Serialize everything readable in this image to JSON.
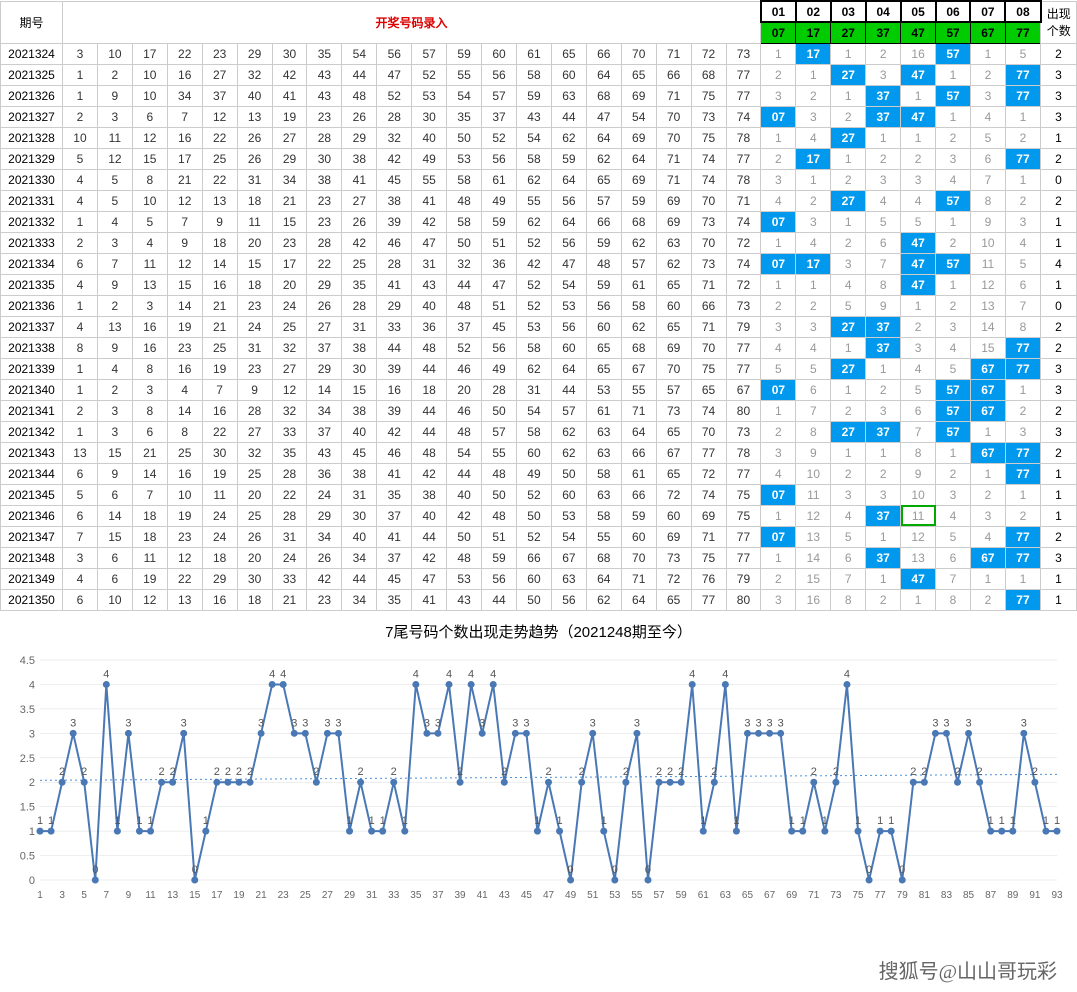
{
  "headers": {
    "period": "期号",
    "draw": "开奖号码录入",
    "count": "出现\n个数",
    "cols": [
      "01",
      "02",
      "03",
      "04",
      "05",
      "06",
      "07",
      "08"
    ],
    "row2": [
      "07",
      "17",
      "27",
      "37",
      "47",
      "57",
      "67",
      "77"
    ]
  },
  "rows": [
    {
      "p": "2021324",
      "d": [
        3,
        10,
        17,
        22,
        23,
        29,
        30,
        35,
        54,
        56,
        57,
        59,
        60,
        61,
        65,
        66,
        70,
        71,
        72,
        73
      ],
      "t": [
        1,
        17,
        1,
        2,
        16,
        57,
        1,
        5
      ],
      "h": [
        0,
        1,
        0,
        0,
        0,
        1,
        0,
        0
      ],
      "c": 2
    },
    {
      "p": "2021325",
      "d": [
        1,
        2,
        10,
        16,
        27,
        32,
        42,
        43,
        44,
        47,
        52,
        55,
        56,
        58,
        60,
        64,
        65,
        66,
        68,
        77
      ],
      "t": [
        2,
        1,
        27,
        3,
        47,
        1,
        2,
        77
      ],
      "h": [
        0,
        0,
        1,
        0,
        1,
        0,
        0,
        1
      ],
      "c": 3
    },
    {
      "p": "2021326",
      "d": [
        1,
        9,
        10,
        34,
        37,
        40,
        41,
        43,
        48,
        52,
        53,
        54,
        57,
        59,
        63,
        68,
        69,
        71,
        75,
        77
      ],
      "t": [
        3,
        2,
        1,
        37,
        1,
        57,
        3,
        77
      ],
      "h": [
        0,
        0,
        0,
        1,
        0,
        1,
        0,
        1
      ],
      "c": 3
    },
    {
      "p": "2021327",
      "d": [
        2,
        3,
        6,
        7,
        12,
        13,
        19,
        23,
        26,
        28,
        30,
        35,
        37,
        43,
        44,
        47,
        54,
        70,
        73,
        74
      ],
      "t": [
        7,
        3,
        2,
        37,
        47,
        1,
        4,
        1
      ],
      "h": [
        1,
        0,
        0,
        1,
        1,
        0,
        0,
        0
      ],
      "c": 3,
      "tval": [
        "07",
        3,
        2,
        37,
        47,
        1,
        4,
        1
      ]
    },
    {
      "p": "2021328",
      "d": [
        10,
        11,
        12,
        16,
        22,
        26,
        27,
        28,
        29,
        32,
        40,
        50,
        52,
        54,
        62,
        64,
        69,
        70,
        75,
        78
      ],
      "t": [
        1,
        4,
        27,
        1,
        1,
        2,
        5,
        2
      ],
      "h": [
        0,
        0,
        1,
        0,
        0,
        0,
        0,
        0
      ],
      "c": 1
    },
    {
      "p": "2021329",
      "d": [
        5,
        12,
        15,
        17,
        25,
        26,
        29,
        30,
        38,
        42,
        49,
        53,
        56,
        58,
        59,
        62,
        64,
        71,
        74,
        77
      ],
      "t": [
        2,
        17,
        1,
        2,
        2,
        3,
        6,
        77
      ],
      "h": [
        0,
        1,
        0,
        0,
        0,
        0,
        0,
        1
      ],
      "c": 2
    },
    {
      "p": "2021330",
      "d": [
        4,
        5,
        8,
        21,
        22,
        31,
        34,
        38,
        41,
        45,
        55,
        58,
        61,
        62,
        64,
        65,
        69,
        71,
        74,
        78
      ],
      "t": [
        3,
        1,
        2,
        3,
        3,
        4,
        7,
        1
      ],
      "h": [
        0,
        0,
        0,
        0,
        0,
        0,
        0,
        0
      ],
      "c": 0
    },
    {
      "p": "2021331",
      "d": [
        4,
        5,
        10,
        12,
        13,
        18,
        21,
        23,
        27,
        38,
        41,
        48,
        49,
        55,
        56,
        57,
        59,
        69,
        70,
        71
      ],
      "t": [
        4,
        2,
        27,
        4,
        4,
        57,
        8,
        2
      ],
      "h": [
        0,
        0,
        1,
        0,
        0,
        1,
        0,
        0
      ],
      "c": 2
    },
    {
      "p": "2021332",
      "d": [
        1,
        4,
        5,
        7,
        9,
        11,
        15,
        23,
        26,
        39,
        42,
        58,
        59,
        62,
        64,
        66,
        68,
        69,
        73,
        74
      ],
      "t": [
        7,
        3,
        1,
        5,
        5,
        1,
        9,
        3
      ],
      "h": [
        1,
        0,
        0,
        0,
        0,
        0,
        0,
        0
      ],
      "c": 1,
      "tval": [
        "07",
        3,
        1,
        5,
        5,
        1,
        9,
        3
      ]
    },
    {
      "p": "2021333",
      "d": [
        2,
        3,
        4,
        9,
        18,
        20,
        23,
        28,
        42,
        46,
        47,
        50,
        51,
        52,
        56,
        59,
        62,
        63,
        70,
        72
      ],
      "t": [
        1,
        4,
        2,
        6,
        47,
        2,
        10,
        4
      ],
      "h": [
        0,
        0,
        0,
        0,
        1,
        0,
        0,
        0
      ],
      "c": 1
    },
    {
      "p": "2021334",
      "d": [
        6,
        7,
        11,
        12,
        14,
        15,
        17,
        22,
        25,
        28,
        31,
        32,
        36,
        42,
        47,
        48,
        57,
        62,
        73,
        74
      ],
      "t": [
        7,
        17,
        3,
        7,
        47,
        57,
        11,
        5
      ],
      "h": [
        1,
        1,
        0,
        0,
        1,
        1,
        0,
        0
      ],
      "c": 4,
      "tval": [
        "07",
        17,
        3,
        7,
        47,
        57,
        11,
        5
      ]
    },
    {
      "p": "2021335",
      "d": [
        4,
        9,
        13,
        15,
        16,
        18,
        20,
        29,
        35,
        41,
        43,
        44,
        47,
        52,
        54,
        59,
        61,
        65,
        71,
        72
      ],
      "t": [
        1,
        1,
        4,
        8,
        47,
        1,
        12,
        6
      ],
      "h": [
        0,
        0,
        0,
        0,
        1,
        0,
        0,
        0
      ],
      "c": 1
    },
    {
      "p": "2021336",
      "d": [
        1,
        2,
        3,
        14,
        21,
        23,
        24,
        26,
        28,
        29,
        40,
        48,
        51,
        52,
        53,
        56,
        58,
        60,
        66,
        73
      ],
      "t": [
        2,
        2,
        5,
        9,
        1,
        2,
        13,
        7
      ],
      "h": [
        0,
        0,
        0,
        0,
        0,
        0,
        0,
        0
      ],
      "c": 0
    },
    {
      "p": "2021337",
      "d": [
        4,
        13,
        16,
        19,
        21,
        24,
        25,
        27,
        31,
        33,
        36,
        37,
        45,
        53,
        56,
        60,
        62,
        65,
        71,
        79
      ],
      "t": [
        3,
        3,
        27,
        37,
        2,
        3,
        14,
        8
      ],
      "h": [
        0,
        0,
        1,
        1,
        0,
        0,
        0,
        0
      ],
      "c": 2
    },
    {
      "p": "2021338",
      "d": [
        8,
        9,
        16,
        23,
        25,
        31,
        32,
        37,
        38,
        44,
        48,
        52,
        56,
        58,
        60,
        65,
        68,
        69,
        70,
        77
      ],
      "t": [
        4,
        4,
        1,
        37,
        3,
        4,
        15,
        77
      ],
      "h": [
        0,
        0,
        0,
        1,
        0,
        0,
        0,
        1
      ],
      "c": 2
    },
    {
      "p": "2021339",
      "d": [
        1,
        4,
        8,
        16,
        19,
        23,
        27,
        29,
        30,
        39,
        44,
        46,
        49,
        62,
        64,
        65,
        67,
        70,
        75,
        77
      ],
      "t": [
        5,
        5,
        27,
        1,
        4,
        5,
        67,
        77
      ],
      "h": [
        0,
        0,
        1,
        0,
        0,
        0,
        1,
        1
      ],
      "c": 3
    },
    {
      "p": "2021340",
      "d": [
        1,
        2,
        3,
        4,
        7,
        9,
        12,
        14,
        15,
        16,
        18,
        20,
        28,
        31,
        44,
        53,
        55,
        57,
        65,
        67
      ],
      "t": [
        7,
        6,
        1,
        2,
        5,
        57,
        67,
        1
      ],
      "h": [
        1,
        0,
        0,
        0,
        0,
        1,
        1,
        0
      ],
      "c": 3,
      "tval": [
        "07",
        6,
        1,
        2,
        5,
        57,
        67,
        1
      ]
    },
    {
      "p": "2021341",
      "d": [
        2,
        3,
        8,
        14,
        16,
        28,
        32,
        34,
        38,
        39,
        44,
        46,
        50,
        54,
        57,
        61,
        71,
        73,
        74,
        80
      ],
      "t": [
        1,
        7,
        2,
        3,
        6,
        57,
        67,
        2
      ],
      "h": [
        0,
        0,
        0,
        0,
        0,
        1,
        1,
        0
      ],
      "c": 2
    },
    {
      "p": "2021342",
      "d": [
        1,
        3,
        6,
        8,
        22,
        27,
        33,
        37,
        40,
        42,
        44,
        48,
        57,
        58,
        62,
        63,
        64,
        65,
        70,
        73
      ],
      "t": [
        2,
        8,
        27,
        37,
        7,
        57,
        1,
        3
      ],
      "h": [
        0,
        0,
        1,
        1,
        0,
        1,
        0,
        0
      ],
      "c": 3
    },
    {
      "p": "2021343",
      "d": [
        13,
        15,
        21,
        25,
        30,
        32,
        35,
        43,
        45,
        46,
        48,
        54,
        55,
        60,
        62,
        63,
        66,
        67,
        77,
        78
      ],
      "t": [
        3,
        9,
        1,
        1,
        8,
        1,
        67,
        77
      ],
      "h": [
        0,
        0,
        0,
        0,
        0,
        0,
        1,
        1
      ],
      "c": 2
    },
    {
      "p": "2021344",
      "d": [
        6,
        9,
        14,
        16,
        19,
        25,
        28,
        36,
        38,
        41,
        42,
        44,
        48,
        49,
        50,
        58,
        61,
        65,
        72,
        77
      ],
      "t": [
        4,
        10,
        2,
        2,
        9,
        2,
        1,
        77
      ],
      "h": [
        0,
        0,
        0,
        0,
        0,
        0,
        0,
        1
      ],
      "c": 1
    },
    {
      "p": "2021345",
      "d": [
        5,
        6,
        7,
        10,
        11,
        20,
        22,
        24,
        31,
        35,
        38,
        40,
        50,
        52,
        60,
        63,
        66,
        72,
        74,
        75
      ],
      "t": [
        7,
        11,
        3,
        3,
        10,
        3,
        2,
        1
      ],
      "h": [
        1,
        0,
        0,
        0,
        0,
        0,
        0,
        0
      ],
      "c": 1,
      "tval": [
        "07",
        11,
        3,
        3,
        10,
        3,
        2,
        1
      ]
    },
    {
      "p": "2021346",
      "d": [
        6,
        14,
        18,
        19,
        24,
        25,
        28,
        29,
        30,
        37,
        40,
        42,
        48,
        50,
        53,
        58,
        59,
        60,
        69,
        75
      ],
      "t": [
        1,
        12,
        4,
        37,
        11,
        4,
        3,
        2
      ],
      "h": [
        0,
        0,
        0,
        1,
        0,
        0,
        0,
        0
      ],
      "c": 1,
      "outline": 4
    },
    {
      "p": "2021347",
      "d": [
        7,
        15,
        18,
        23,
        24,
        26,
        31,
        34,
        40,
        41,
        44,
        50,
        51,
        52,
        54,
        55,
        60,
        69,
        71,
        77
      ],
      "t": [
        7,
        13,
        5,
        1,
        12,
        5,
        4,
        77
      ],
      "h": [
        1,
        0,
        0,
        0,
        0,
        0,
        0,
        1
      ],
      "c": 2,
      "tval": [
        "07",
        13,
        5,
        1,
        12,
        5,
        4,
        77
      ]
    },
    {
      "p": "2021348",
      "d": [
        3,
        6,
        11,
        12,
        18,
        20,
        24,
        26,
        34,
        37,
        42,
        48,
        59,
        66,
        67,
        68,
        70,
        73,
        75,
        77
      ],
      "t": [
        1,
        14,
        6,
        37,
        13,
        6,
        67,
        77
      ],
      "h": [
        0,
        0,
        0,
        1,
        0,
        0,
        1,
        1
      ],
      "c": 3
    },
    {
      "p": "2021349",
      "d": [
        4,
        6,
        19,
        22,
        29,
        30,
        33,
        42,
        44,
        45,
        47,
        53,
        56,
        60,
        63,
        64,
        71,
        72,
        76,
        79
      ],
      "t": [
        2,
        15,
        7,
        1,
        47,
        7,
        1,
        1
      ],
      "h": [
        0,
        0,
        0,
        0,
        1,
        0,
        0,
        0
      ],
      "c": 1
    },
    {
      "p": "2021350",
      "d": [
        6,
        10,
        12,
        13,
        16,
        18,
        21,
        23,
        34,
        35,
        41,
        43,
        44,
        50,
        56,
        62,
        64,
        65,
        77,
        80
      ],
      "t": [
        3,
        16,
        8,
        2,
        1,
        8,
        2,
        77
      ],
      "h": [
        0,
        0,
        0,
        0,
        0,
        0,
        0,
        1
      ],
      "c": 1
    }
  ],
  "chart_data": {
    "type": "line",
    "title": "7尾号码个数出现走势趋势（2021248期至今）",
    "xlabel": "",
    "ylabel": "",
    "ylim": [
      0,
      4.5
    ],
    "yticks": [
      0,
      0.5,
      1,
      1.5,
      2,
      2.5,
      3,
      3.5,
      4,
      4.5
    ],
    "x": [
      1,
      3,
      5,
      7,
      9,
      11,
      13,
      15,
      17,
      19,
      21,
      23,
      25,
      27,
      29,
      31,
      33,
      35,
      37,
      39,
      41,
      43,
      45,
      47,
      49,
      51,
      53,
      55,
      57,
      59,
      61,
      63,
      65,
      67,
      69,
      71,
      73,
      75,
      77,
      79,
      81,
      83,
      85,
      87,
      89,
      91,
      93
    ],
    "values": [
      1,
      1,
      2,
      3,
      2,
      0,
      4,
      1,
      3,
      1,
      1,
      2,
      2,
      3,
      0,
      1,
      2,
      2,
      2,
      2,
      3,
      4,
      4,
      3,
      3,
      2,
      3,
      3,
      1,
      2,
      1,
      1,
      2,
      1,
      4,
      3,
      3,
      4,
      2,
      4,
      3,
      4,
      2,
      3,
      3,
      1,
      2,
      1,
      0,
      2,
      3,
      1,
      0,
      2,
      3,
      0,
      2,
      2,
      2,
      4,
      1,
      2,
      4,
      1,
      3,
      3,
      3,
      3,
      1,
      1,
      2,
      1,
      2,
      4,
      1,
      0,
      1,
      1,
      0,
      2,
      2,
      3,
      3,
      2,
      3,
      2,
      1,
      1,
      1,
      3,
      2,
      1,
      1
    ],
    "trend": 2.1
  },
  "watermark": "搜狐号@山山哥玩彩"
}
